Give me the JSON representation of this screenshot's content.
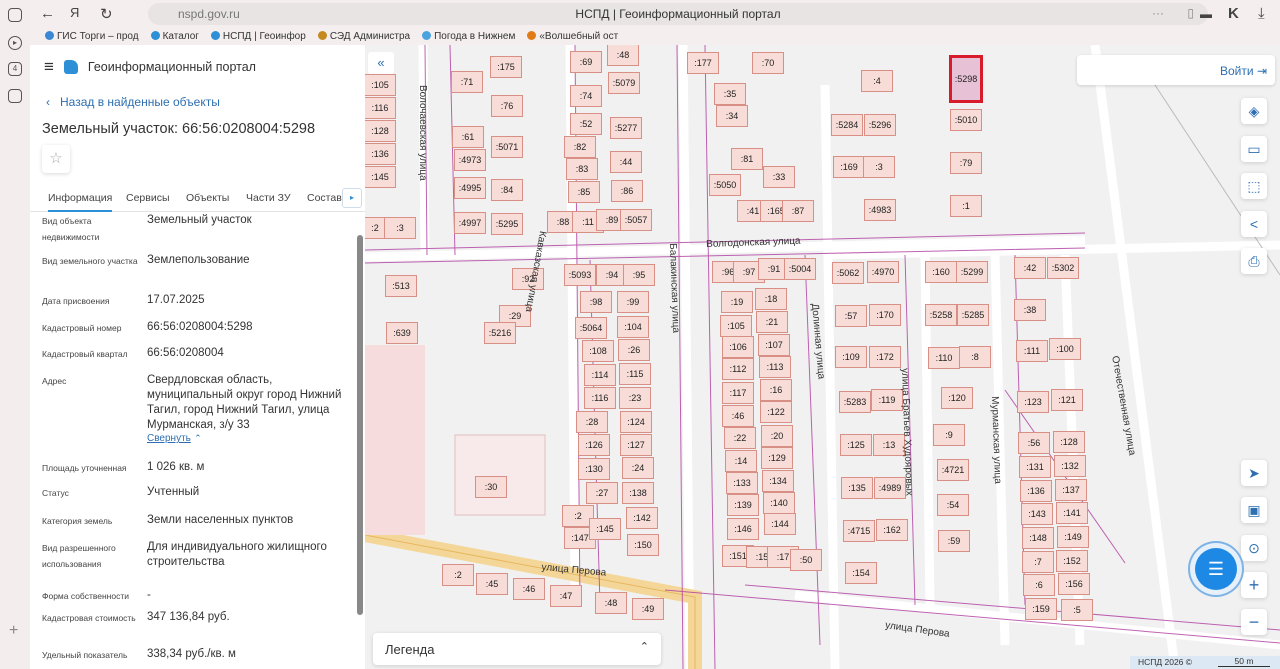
{
  "browser": {
    "url": "nspd.gov.ru",
    "title": "НСПД | Геоинформационный портал",
    "bookmarks": [
      {
        "label": "ГИС Торги – прод",
        "color": "#3a87d6"
      },
      {
        "label": "Каталог",
        "color": "#2d8fd5"
      },
      {
        "label": "НСПД | Геоинфор",
        "color": "#2d8fd5"
      },
      {
        "label": "СЭД Администра",
        "color": "#c58a1f"
      },
      {
        "label": "Погода в Нижнем",
        "color": "#4aa3df"
      },
      {
        "label": "«Волшебный ост",
        "color": "#e07b18"
      }
    ]
  },
  "header": {
    "title": "Геоинформационный портал"
  },
  "back_link": "Назад в найденные объекты",
  "page_title": "Земельный участок: 66:56:0208004:5298",
  "tabs": [
    "Информация",
    "Сервисы",
    "Объекты",
    "Части ЗУ",
    "Состав"
  ],
  "props": [
    {
      "k": "Вид объекта недвижимости",
      "v": "Земельный участок"
    },
    {
      "k": "Вид земельного участка",
      "v": "Землепользование"
    },
    {
      "k": "Дата присвоения",
      "v": "17.07.2025"
    },
    {
      "k": "Кадастровый номер",
      "v": "66:56:0208004:5298"
    },
    {
      "k": "Кадастровый квартал",
      "v": "66:56:0208004"
    },
    {
      "k": "Адрес",
      "v": "Свердловская область, муниципальный округ город Нижний Тагил, город Нижний Тагил, улица Мурманская, з/у 33"
    },
    {
      "k": "Площадь уточненная",
      "v": "1 026 кв. м"
    },
    {
      "k": "Статус",
      "v": "Учтенный"
    },
    {
      "k": "Категория земель",
      "v": "Земли населенных пунктов"
    },
    {
      "k": "Вид разрешенного использования",
      "v": "Для индивидуального жилищного строительства"
    },
    {
      "k": "Форма собственности",
      "v": "-"
    },
    {
      "k": "Кадастровая стоимость",
      "v": "347 136,84 руб."
    },
    {
      "k": "Удельный показатель",
      "v": "338,34 руб./кв. м"
    }
  ],
  "collapse_label": "Свернуть",
  "map": {
    "login": "Войти",
    "legend": "Легенда",
    "copyright": "НСПД 2026 ©",
    "scale": "50 m",
    "streets": [
      "Волочаевская улица",
      "Кавказская улица",
      "Балакинская улица",
      "Волгодонская улица",
      "Долинная улица",
      "улица Братьев Худояровых",
      "Мурманская улица",
      "Отечественная улица",
      "улица Перова",
      "улица Перова"
    ],
    "parcels": [
      ":105",
      ":116",
      ":128",
      ":136",
      ":145",
      ":2",
      ":3",
      ":71",
      ":61",
      ":4973",
      ":4995",
      ":4997",
      ":175",
      ":76",
      ":5071",
      ":84",
      ":5295",
      ":48",
      ":69",
      ":5079",
      ":74",
      ":52",
      ":5277",
      ":82",
      ":44",
      ":83",
      ":85",
      ":86",
      ":88",
      ":11",
      ":89",
      ":5057",
      ":177",
      ":70",
      ":35",
      ":34",
      ":81",
      ":33",
      ":5050",
      ":41",
      ":165",
      ":87",
      ":4",
      ":5284",
      ":5296",
      ":169",
      ":3",
      ":4983",
      ":5298",
      ":5010",
      ":79",
      ":1",
      ":513",
      ":639",
      ":92",
      ":29",
      ":5216",
      ":30",
      ":5093",
      ":94",
      ":95",
      ":98",
      ":99",
      ":5064",
      ":104",
      ":108",
      ":26",
      ":114",
      ":115",
      ":116",
      ":23",
      ":28",
      ":124",
      ":126",
      ":127",
      ":130",
      ":24",
      ":27",
      ":138",
      ":2",
      ":142",
      ":147",
      ":145",
      ":150",
      ":96",
      ":97",
      ":91",
      ":5004",
      ":19",
      ":18",
      ":105",
      ":21",
      ":106",
      ":107",
      ":112",
      ":113",
      ":117",
      ":16",
      ":46",
      ":122",
      ":22",
      ":20",
      ":14",
      ":129",
      ":133",
      ":134",
      ":139",
      ":140",
      ":146",
      ":144",
      ":151",
      ":15",
      ":17",
      ":50",
      ":5062",
      ":4970",
      ":57",
      ":170",
      ":109",
      ":172",
      ":5283",
      ":119",
      ":125",
      ":13",
      ":135",
      ":4989",
      ":4715",
      ":162",
      ":154",
      ":160",
      ":5299",
      ":5258",
      ":5285",
      ":110",
      ":8",
      ":120",
      ":9",
      ":4721",
      ":54",
      ":59",
      ":42",
      ":5302",
      ":38",
      ":111",
      ":100",
      ":123",
      ":121",
      ":56",
      ":128",
      ":131",
      ":132",
      ":136",
      ":137",
      ":143",
      ":141",
      ":148",
      ":149",
      ":7",
      ":152",
      ":6",
      ":156",
      ":159",
      ":5",
      ":2",
      ":45",
      ":46",
      ":47",
      ":48",
      ":49"
    ],
    "selected": ":5298"
  }
}
